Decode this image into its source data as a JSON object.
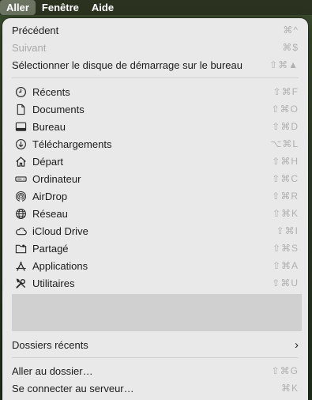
{
  "menubar": {
    "items": [
      {
        "label": "Aller",
        "active": true
      },
      {
        "label": "Fenêtre",
        "active": false
      },
      {
        "label": "Aide",
        "active": false
      }
    ]
  },
  "menu": {
    "group1": [
      {
        "label": "Précédent",
        "shortcut": "⌘^",
        "enabled": true
      },
      {
        "label": "Suivant",
        "shortcut": "⌘$",
        "enabled": false
      },
      {
        "label": "Sélectionner le disque de démarrage sur le bureau",
        "shortcut": "⇧⌘▲",
        "enabled": true
      }
    ],
    "places": [
      {
        "label": "Récents",
        "shortcut": "⇧⌘F",
        "icon": "clock-icon"
      },
      {
        "label": "Documents",
        "shortcut": "⇧⌘O",
        "icon": "document-icon"
      },
      {
        "label": "Bureau",
        "shortcut": "⇧⌘D",
        "icon": "desktop-icon"
      },
      {
        "label": "Téléchargements",
        "shortcut": "⌥⌘L",
        "icon": "download-icon"
      },
      {
        "label": "Départ",
        "shortcut": "⇧⌘H",
        "icon": "home-icon"
      },
      {
        "label": "Ordinateur",
        "shortcut": "⇧⌘C",
        "icon": "computer-icon"
      },
      {
        "label": "AirDrop",
        "shortcut": "⇧⌘R",
        "icon": "airdrop-icon"
      },
      {
        "label": "Réseau",
        "shortcut": "⇧⌘K",
        "icon": "network-icon"
      },
      {
        "label": "iCloud Drive",
        "shortcut": "⇧⌘I",
        "icon": "cloud-icon"
      },
      {
        "label": "Partagé",
        "shortcut": "⇧⌘S",
        "icon": "shared-folder-icon"
      },
      {
        "label": "Applications",
        "shortcut": "⇧⌘A",
        "icon": "applications-icon"
      },
      {
        "label": "Utilitaires",
        "shortcut": "⇧⌘U",
        "icon": "utilities-icon"
      }
    ],
    "recent_folders": {
      "label": "Dossiers récents"
    },
    "goto_folder": {
      "label": "Aller au dossier…",
      "shortcut": "⇧⌘G"
    },
    "connect_server": {
      "label": "Se connecter au serveur…",
      "shortcut": "⌘K"
    }
  },
  "colors": {
    "menu_bg": "#e9e9e9",
    "menubar_bg": "#2b3320",
    "shortcut": "#b0b0b0",
    "disabled": "#a9a9a9"
  }
}
